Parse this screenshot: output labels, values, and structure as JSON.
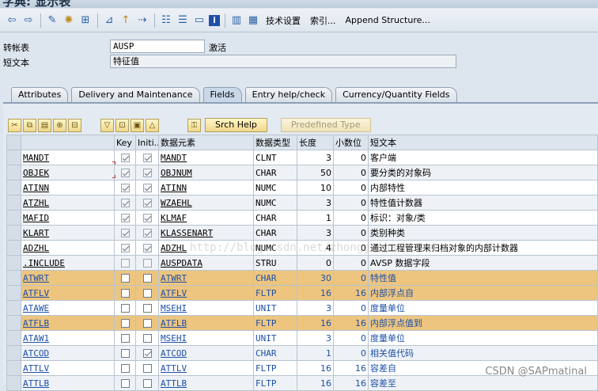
{
  "window": {
    "title": "字典: 显示表"
  },
  "toolbar": {
    "icons": [
      "back-arrow",
      "forward-arrow",
      "edit-pencil",
      "activate",
      "where-used",
      "hierarchy",
      "object-list",
      "navigate",
      "settings",
      "display-object",
      "info"
    ],
    "tech_settings": "技术设置",
    "index": "索引...",
    "append_structure": "Append Structure..."
  },
  "header": {
    "table_label": "转帐表",
    "table_value": "AUSP",
    "status": "激活",
    "short_text_label": "短文本",
    "short_text_value": "特征值"
  },
  "tabs": [
    {
      "label": "Attributes"
    },
    {
      "label": "Delivery and Maintenance"
    },
    {
      "label": "Fields"
    },
    {
      "label": "Entry help/check"
    },
    {
      "label": "Currency/Quantity Fields"
    }
  ],
  "table_toolbar": {
    "srch_help": "Srch Help",
    "predefined_type": "Predefined Type"
  },
  "columns": {
    "field": "",
    "key": "Key",
    "initial": "Initi...",
    "data_element": "数据元素",
    "data_type": "数据类型",
    "length": "长度",
    "decimals": "小数位",
    "short_text": "短文本"
  },
  "rows": [
    {
      "field": "MANDT",
      "key": true,
      "initial": true,
      "de": "MANDT",
      "type": "CLNT",
      "len": "3",
      "dec": "0",
      "desc": "客户端"
    },
    {
      "field": "OBJEK",
      "key": true,
      "initial": true,
      "de": "OBJNUM",
      "type": "CHAR",
      "len": "50",
      "dec": "0",
      "desc": "要分类的对象码"
    },
    {
      "field": "ATINN",
      "key": true,
      "initial": true,
      "de": "ATINN",
      "type": "NUMC",
      "len": "10",
      "dec": "0",
      "desc": "内部特性"
    },
    {
      "field": "ATZHL",
      "key": true,
      "initial": true,
      "de": "WZAEHL",
      "type": "NUMC",
      "len": "3",
      "dec": "0",
      "desc": "特性值计数器"
    },
    {
      "field": "MAFID",
      "key": true,
      "initial": true,
      "de": "KLMAF",
      "type": "CHAR",
      "len": "1",
      "dec": "0",
      "desc": "标识：对象/类"
    },
    {
      "field": "KLART",
      "key": true,
      "initial": true,
      "de": "KLASSENART",
      "type": "CHAR",
      "len": "3",
      "dec": "0",
      "desc": "类别种类"
    },
    {
      "field": "ADZHL",
      "key": true,
      "initial": true,
      "de": "ADZHL",
      "type": "NUMC",
      "len": "4",
      "dec": "0",
      "desc": "通过工程管理来归档对象的内部计数器"
    },
    {
      "field": ".INCLUDE",
      "key": false,
      "initial": false,
      "de": "AUSPDATA",
      "type": "STRU",
      "len": "0",
      "dec": "0",
      "desc": "AVSP 数据字段"
    },
    {
      "field": "ATWRT",
      "key": false,
      "initial": false,
      "de": "ATWRT",
      "type": "CHAR",
      "len": "30",
      "dec": "0",
      "desc": "特性值"
    },
    {
      "field": "ATFLV",
      "key": false,
      "initial": false,
      "de": "ATFLV",
      "type": "FLTP",
      "len": "16",
      "dec": "16",
      "desc": "内部浮点自"
    },
    {
      "field": "ATAWE",
      "key": false,
      "initial": false,
      "de": "MSEHI",
      "type": "UNIT",
      "len": "3",
      "dec": "0",
      "desc": "度量单位"
    },
    {
      "field": "ATFLB",
      "key": false,
      "initial": false,
      "de": "ATFLB",
      "type": "FLTP",
      "len": "16",
      "dec": "16",
      "desc": "内部浮点值到"
    },
    {
      "field": "ATAW1",
      "key": false,
      "initial": false,
      "de": "MSEHI",
      "type": "UNIT",
      "len": "3",
      "dec": "0",
      "desc": "度量单位"
    },
    {
      "field": "ATCOD",
      "key": false,
      "initial": true,
      "de": "ATCOD",
      "type": "CHAR",
      "len": "1",
      "dec": "0",
      "desc": "相关值代码"
    },
    {
      "field": "ATTLV",
      "key": false,
      "initial": false,
      "de": "ATTLV",
      "type": "FLTP",
      "len": "16",
      "dec": "16",
      "desc": "容差自"
    },
    {
      "field": "ATTLB",
      "key": false,
      "initial": false,
      "de": "ATTLB",
      "type": "FLTP",
      "len": "16",
      "dec": "16",
      "desc": "容差至"
    }
  ],
  "highlight_rows": [
    8,
    9,
    11
  ],
  "blue_rows_from": 8,
  "watermark": "CSDN @SAPmatinal",
  "ghost_text": "http://blog.csdn.net/zhongguomao",
  "colors": {
    "highlight": "#edc57f",
    "link_blue": "#1d4fa8",
    "background": "#dde5ee"
  }
}
